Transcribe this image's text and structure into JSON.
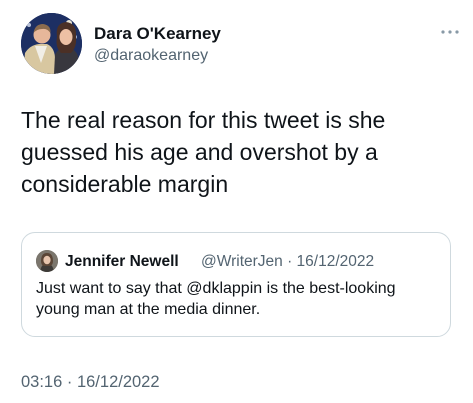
{
  "author": {
    "display_name": "Dara O'Kearney",
    "handle": "@daraokearney"
  },
  "tweet": {
    "text": "The real reason for this tweet is she guessed his age and overshot by a considerable margin",
    "timestamp": "03:16 · 16/12/2022"
  },
  "quoted_tweet": {
    "display_name": "Jennifer Newell",
    "handle_and_date": "@WriterJen · 16/12/2022",
    "text": "Just want to say that @dklappin is the best-looking young man at the media dinner."
  },
  "icons": {
    "more": "more-horizontal-icon",
    "author_avatar": "avatar-photo",
    "quoted_avatar": "avatar-photo"
  },
  "colors": {
    "primary_text": "#0f1419",
    "secondary_text": "#536471",
    "border": "#cfd9de",
    "background": "#ffffff"
  }
}
